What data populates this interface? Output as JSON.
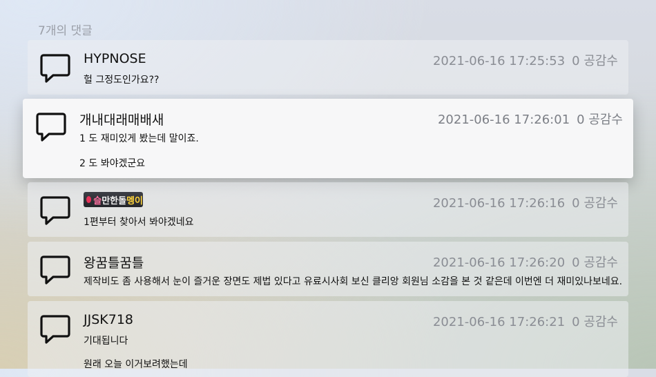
{
  "header": {
    "title": "7개의 댓글"
  },
  "comments": [
    {
      "author": "HYPNOSE",
      "date": "2021-06-16 17:25:53",
      "likes": "0 공감수",
      "lines": [
        "헐 그정도인가요??"
      ]
    },
    {
      "author": "개내대래매배새",
      "date": "2021-06-16 17:26:01",
      "likes": "0 공감수",
      "lines": [
        "1 도 재미있게 봤는데 말이죠.",
        "2 도 봐야겠군요"
      ]
    },
    {
      "author": "슬만한돌멩이",
      "author_badge_parts": [
        "슬",
        "만한돌",
        "멩이"
      ],
      "date": "2021-06-16 17:26:16",
      "likes": "0 공감수",
      "lines": [
        "1편부터 찾아서 봐야겠네요"
      ]
    },
    {
      "author": "왕꿈틀꿈틀",
      "date": "2021-06-16 17:26:20",
      "likes": "0 공감수",
      "lines": [
        "제작비도 좀 사용해서 눈이 즐거운 장면도 제법 있다고 유료시사회 보신 클리앙 회원님 소감을 본 것 같은데 이번엔 더 재미있나보네요."
      ]
    },
    {
      "author": "JJSK718",
      "date": "2021-06-16 17:26:21",
      "likes": "0 공감수",
      "lines": [
        "기대됩니다",
        "원래 오늘 이거보려했는데"
      ]
    }
  ],
  "icons": {
    "comment": "speech-bubble-icon"
  },
  "colors": {
    "text": "#111111",
    "meta": "#8a8d94",
    "focused_card": "#f7f7f8"
  }
}
